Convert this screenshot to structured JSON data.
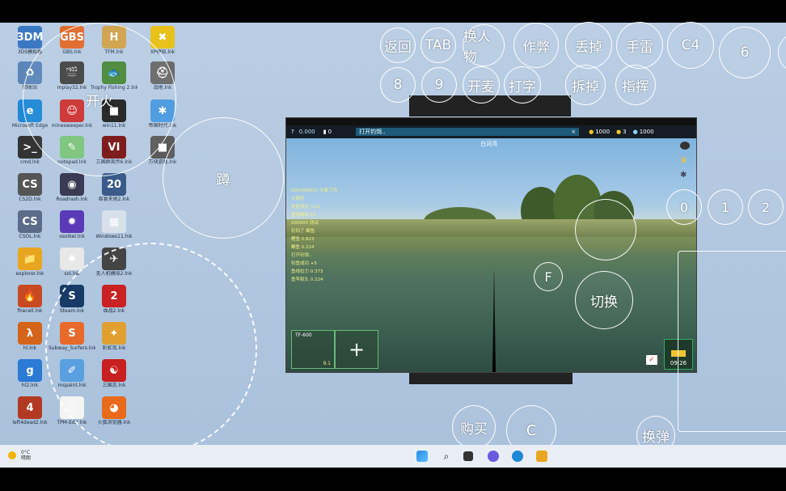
{
  "desktop": {
    "icons": [
      {
        "label": "3DS模拟器",
        "glyph": "3DM",
        "color": "#3b78c4"
      },
      {
        "label": "回收站",
        "glyph": "♻",
        "color": "#5a86b9"
      },
      {
        "label": "Microsoft Edge",
        "glyph": "e",
        "color": "#1f88d6"
      },
      {
        "label": "cmd.lnk",
        "glyph": ">_",
        "color": "#333333"
      },
      {
        "label": "CS2D.lnk",
        "glyph": "CS",
        "color": "#555555"
      },
      {
        "label": "CSOL.lnk",
        "glyph": "CS",
        "color": "#5a6c8a"
      },
      {
        "label": "explorer.lnk",
        "glyph": "📁",
        "color": "#e8a620"
      },
      {
        "label": "firecell.lnk",
        "glyph": "🔥",
        "color": "#c84a22"
      },
      {
        "label": "hl.lnk",
        "glyph": "λ",
        "color": "#d4641a"
      },
      {
        "label": "hl2.lnk",
        "glyph": "g",
        "color": "#2a7ad6"
      },
      {
        "label": "left4dead2.lnk",
        "glyph": "4",
        "color": "#b33a22"
      },
      {
        "label": "GBS.lnk",
        "glyph": "GBS",
        "color": "#e06a2a"
      },
      {
        "label": "mplay32.lnk",
        "glyph": "🎬",
        "color": "#444444"
      },
      {
        "label": "minesweeper.lnk",
        "glyph": "☺",
        "color": "#cc3333"
      },
      {
        "label": "notepad.lnk",
        "glyph": "✎",
        "color": "#7cc47c"
      },
      {
        "label": "Roadrash.lnk",
        "glyph": "◉",
        "color": "#3a3a55"
      },
      {
        "label": "osolkel.lnk",
        "glyph": "✹",
        "color": "#5a3ab8"
      },
      {
        "label": "sol.lnk",
        "glyph": "♠",
        "color": "#e8e8e8"
      },
      {
        "label": "Steam.lnk",
        "glyph": "S",
        "color": "#173a66"
      },
      {
        "label": "Subway_Surfers.lnk",
        "glyph": "S",
        "color": "#e86a2a"
      },
      {
        "label": "mspaint.lnk",
        "glyph": "✐",
        "color": "#5aa0e0"
      },
      {
        "label": "TPM-Edit.lnk",
        "glyph": "▯",
        "color": "#f4f4f4"
      },
      {
        "label": "TFM.lnk",
        "glyph": "H",
        "color": "#d0a24a"
      },
      {
        "label": "Trophy Fishing 2.lnk",
        "glyph": "🐟",
        "color": "#4a8a3a"
      },
      {
        "label": "win11.lnk",
        "glyph": "■",
        "color": "#222222"
      },
      {
        "label": "三国群英传6.lnk",
        "glyph": "VI",
        "color": "#7a1414"
      },
      {
        "label": "吞食天地2.lnk",
        "glyph": "20",
        "color": "#3a5a8a"
      },
      {
        "label": "Windows11.lnk",
        "glyph": "▦",
        "color": "#d8e0ea"
      },
      {
        "label": "无人机模拟2.lnk",
        "glyph": "✈",
        "color": "#444444"
      },
      {
        "label": "血战2.lnk",
        "glyph": "2",
        "color": "#c82222"
      },
      {
        "label": "彩虹岛.lnk",
        "glyph": "✦",
        "color": "#e0a030"
      },
      {
        "label": "三国志.lnk",
        "glyph": "☯",
        "color": "#c82020"
      },
      {
        "label": "火狐浏览器.lnk",
        "glyph": "◕",
        "color": "#e86a1a"
      },
      {
        "label": "XP模拟.lnk",
        "glyph": "✖",
        "color": "#e8c21a"
      },
      {
        "label": "战地.lnk",
        "glyph": "⛑",
        "color": "#6a6a6a"
      },
      {
        "label": "帝国时代.lnk",
        "glyph": "✱",
        "color": "#4a9ae0"
      },
      {
        "label": "方块游戏.lnk",
        "glyph": "■",
        "color": "#5a5a5a"
      }
    ]
  },
  "overlay": {
    "top_row": [
      "返回",
      "TAB",
      "换人物",
      "作弊",
      "丢掉",
      "手雷",
      "C4",
      "6"
    ],
    "second_row": [
      "8",
      "9",
      "开麦",
      "打字",
      "拆掉",
      "指挥"
    ],
    "num_keys": [
      "0",
      "1",
      "2"
    ],
    "fire_label": "开火",
    "jump_label": "蹲",
    "f_key": "F",
    "switch_label": "切换",
    "buy_label": "购买",
    "c_key": "C",
    "reload_label": "换弹"
  },
  "game": {
    "hud_left": "0.000",
    "hud_mid": "0",
    "hud_chat": "打开钓饵..",
    "hud_close": "×",
    "hud_money": "1000",
    "hud_coins": "3",
    "hud_right": "1000",
    "area_label": "白河湾",
    "chat_lines": [
      "000/000007 大家了吗",
      "大家好",
      "钓鱼成功 +10",
      "鱼饵剩余 12",
      "000000 测试",
      "钓到了 鲫鱼",
      "鲤鱼 0.823",
      "鲫鱼 0.224",
      "打开钓饵..",
      "钓鱼成功 +5",
      "鱼线拉力 0.373",
      "鱼竿耐久 0.224"
    ],
    "slot1_label": "TF-600",
    "slot1_count": "9.1",
    "slot2_label": "+",
    "clock": "09:26"
  },
  "taskbar": {
    "weather_temp": "0°C",
    "weather_desc": "晴朗"
  },
  "colors": {
    "desktop_bg": "#b3c9e1",
    "overlay_stroke": "#ffffff"
  }
}
